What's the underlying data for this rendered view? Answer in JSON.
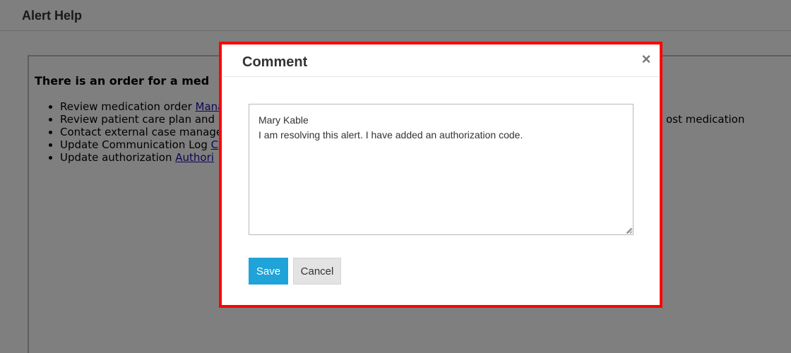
{
  "page": {
    "title": "Alert Help"
  },
  "content": {
    "heading": "There is an order for a med",
    "items": [
      {
        "text": "Review medication order ",
        "link": "Mana"
      },
      {
        "text": "Review patient care plan and",
        "link": ""
      },
      {
        "text": "Contact external case manage",
        "link": ""
      },
      {
        "text": "Update Communication Log ",
        "link": "C"
      },
      {
        "text": "Update authorization  ",
        "link": "Authori"
      }
    ],
    "item2_trailing": "ost medication"
  },
  "modal": {
    "title": "Comment",
    "close_symbol": "×",
    "comment_lines": [
      "Mary Kable",
      "I am resolving this alert. I have added an authorization code."
    ],
    "save_label": "Save",
    "cancel_label": "Cancel"
  },
  "colors": {
    "highlight_border": "#ff0000",
    "save_button": "#1fa3d8",
    "link": "#1a0dab"
  }
}
